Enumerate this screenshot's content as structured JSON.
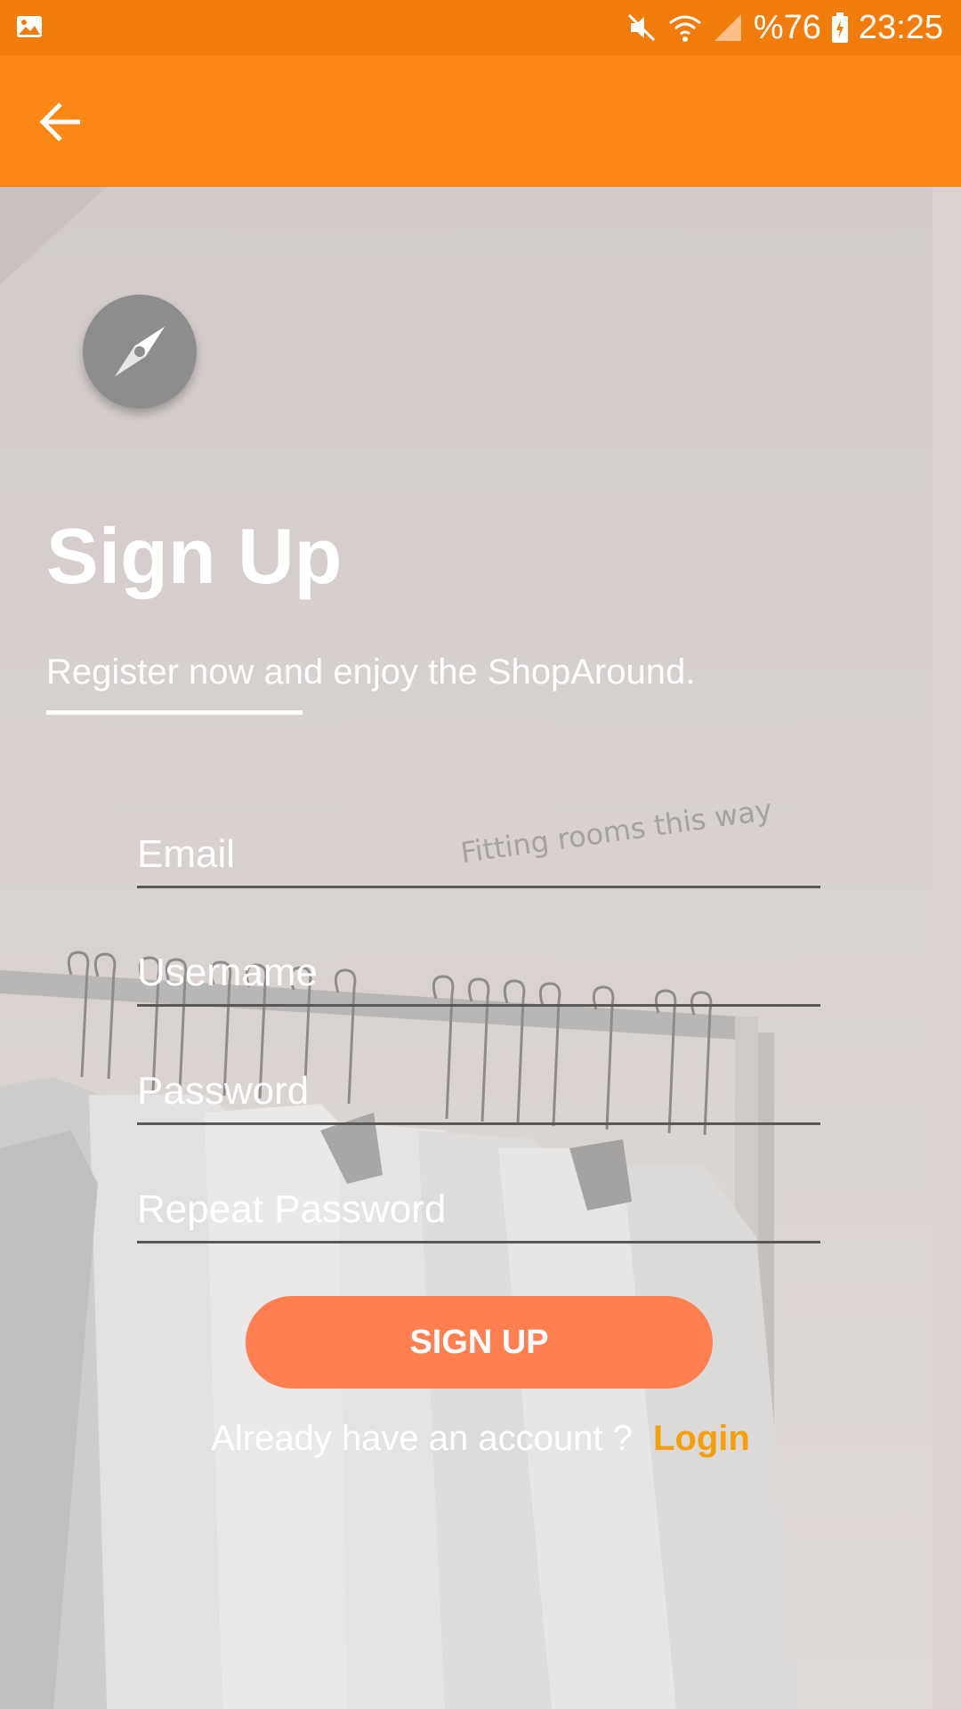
{
  "status_bar": {
    "battery": "%76",
    "time": "23:25"
  },
  "page": {
    "title": "Sign Up",
    "subtitle": "Register now and enjoy the ShopAround.",
    "background_sign": "Fitting rooms this way"
  },
  "form": {
    "email_placeholder": "Email",
    "username_placeholder": "Username",
    "password_placeholder": "Password",
    "repeat_password_placeholder": "Repeat Password",
    "submit_label": "SIGN UP"
  },
  "footer": {
    "prompt": "Already have an account ?",
    "login_label": "Login"
  },
  "colors": {
    "status_bar": "#f27c0a",
    "app_bar": "#fb8715",
    "button": "#ff7f50",
    "login_link": "#f5a00a"
  }
}
